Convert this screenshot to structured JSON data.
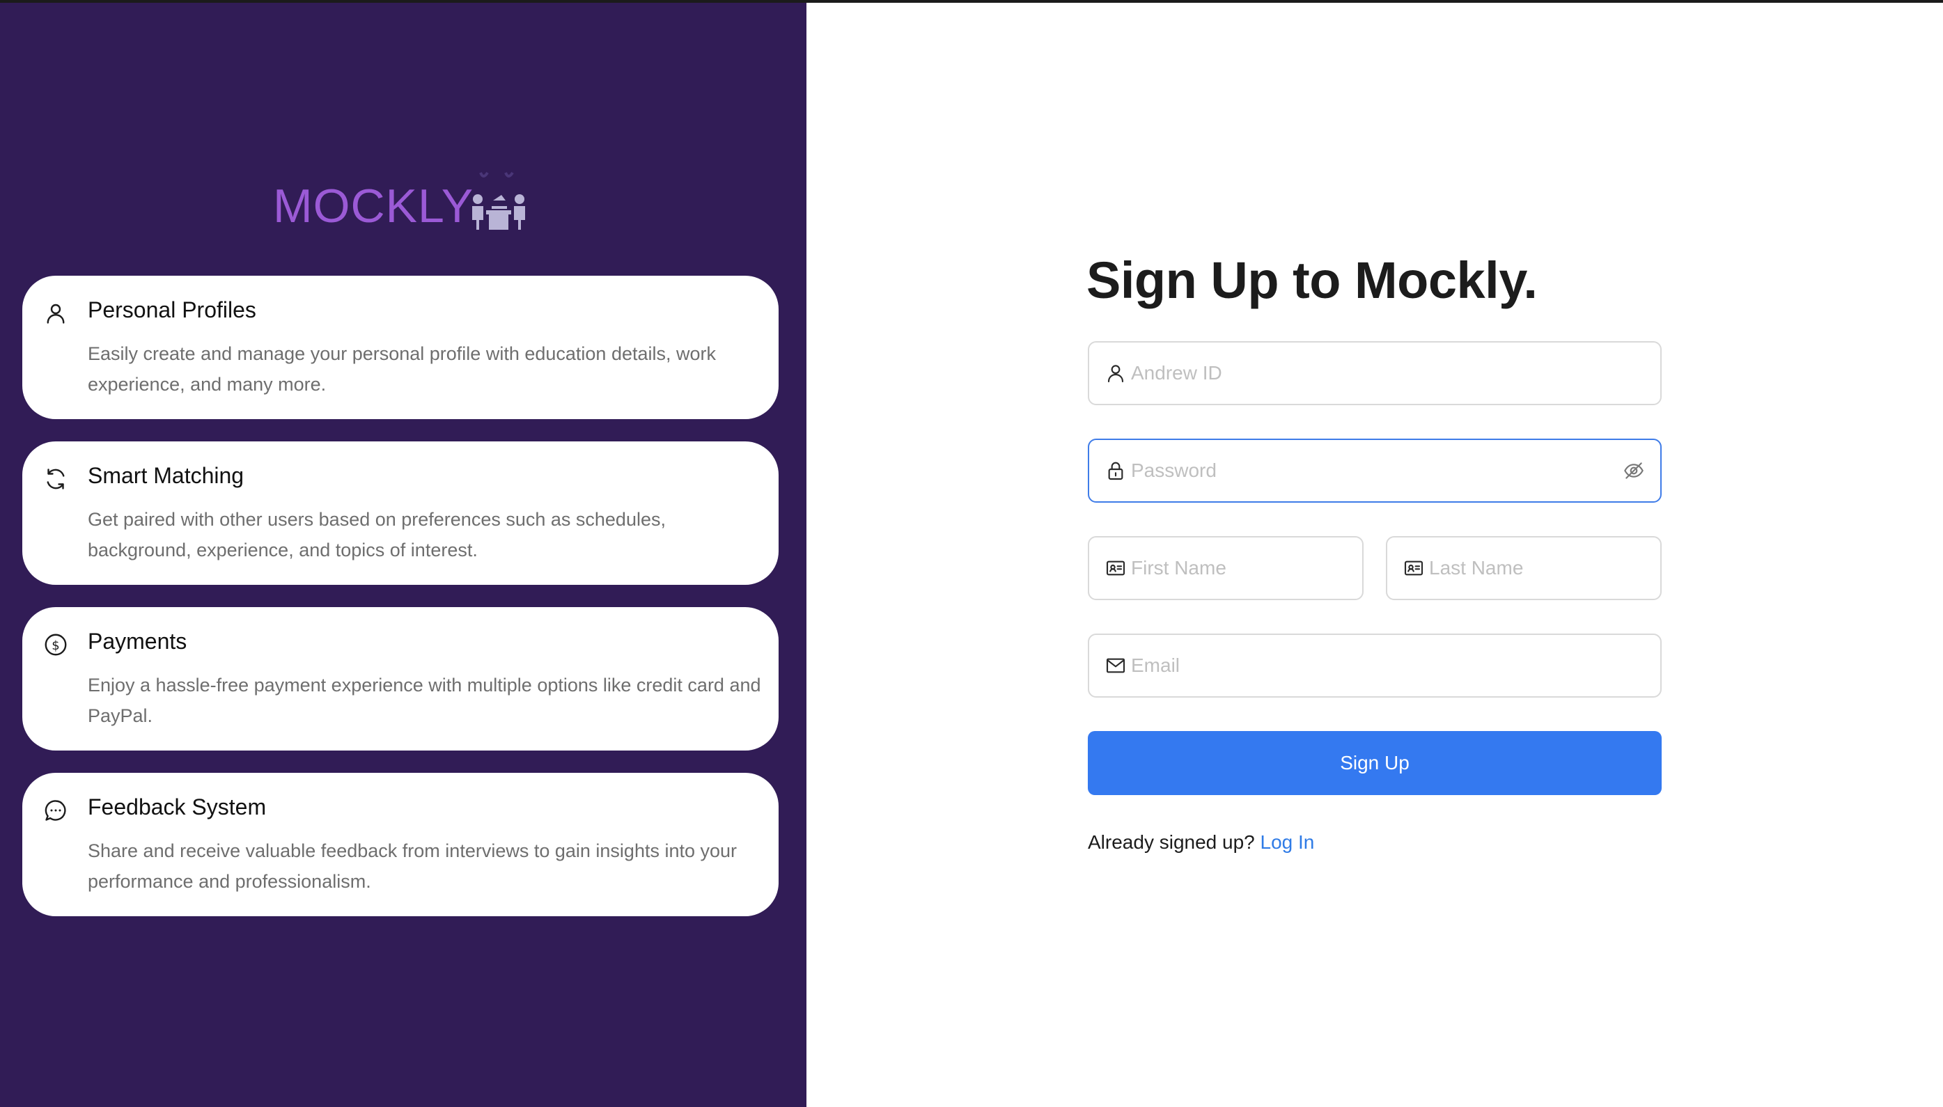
{
  "brand": {
    "name": "MOCKLY",
    "logo_icon": "interview-people-icon",
    "color": "#9b5ad6"
  },
  "left_panel": {
    "background": "#311c56",
    "features": [
      {
        "icon": "user-icon",
        "title": "Personal Profiles",
        "description": "Easily create and manage your personal profile with education details, work experience, and many more."
      },
      {
        "icon": "refresh-icon",
        "title": "Smart Matching",
        "description": "Get paired with other users based on preferences such as schedules, background, experience, and topics of interest."
      },
      {
        "icon": "dollar-circle-icon",
        "title": "Payments",
        "description": "Enjoy a hassle-free payment experience with multiple options like credit card and PayPal."
      },
      {
        "icon": "chat-bubble-icon",
        "title": "Feedback System",
        "description": "Share and receive valuable feedback from interviews to gain insights into your performance and professionalism."
      }
    ]
  },
  "form": {
    "title": "Sign Up to Mockly.",
    "andrew_id": {
      "placeholder": "Andrew ID",
      "value": "",
      "icon": "user-icon"
    },
    "password": {
      "placeholder": "Password",
      "value": "",
      "icon": "lock-icon",
      "toggle_icon": "eye-off-icon"
    },
    "first_name": {
      "placeholder": "First Name",
      "value": "",
      "icon": "id-card-icon"
    },
    "last_name": {
      "placeholder": "Last Name",
      "value": "",
      "icon": "id-card-icon"
    },
    "email": {
      "placeholder": "Email",
      "value": "",
      "icon": "mail-icon"
    },
    "submit_label": "Sign Up",
    "login_prompt": "Already signed up?",
    "login_link": "Log In",
    "accent_color": "#3479f0"
  }
}
